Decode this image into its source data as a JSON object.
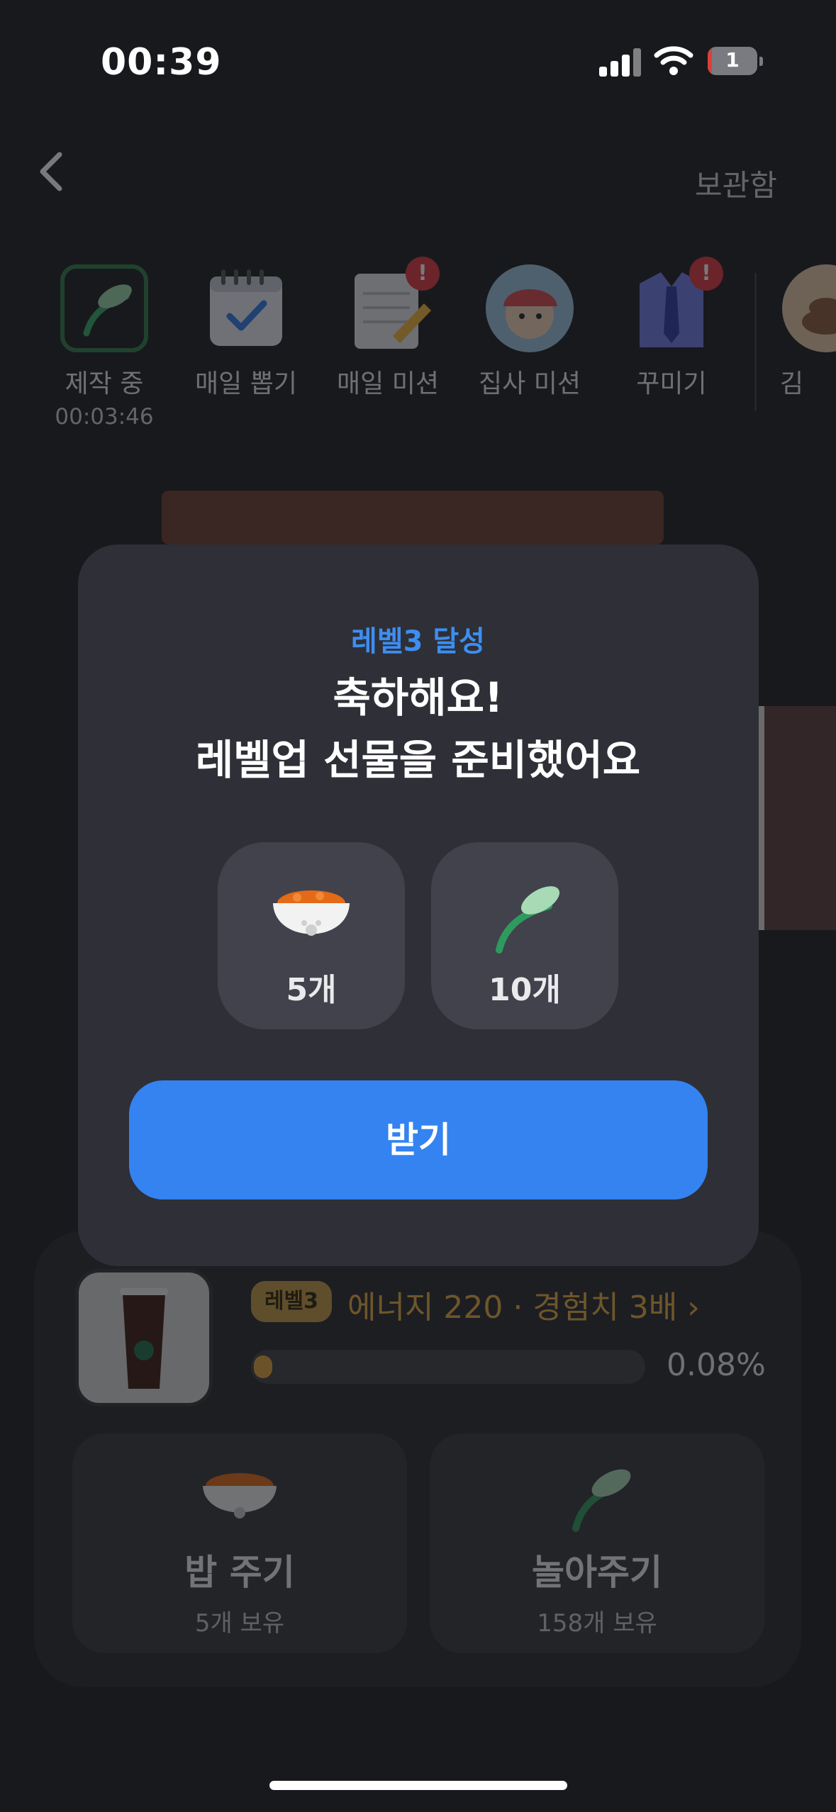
{
  "status_bar": {
    "time": "00:39",
    "battery": "1"
  },
  "header": {
    "storage_label": "보관함"
  },
  "menu": [
    {
      "label": "제작 중",
      "sub": "00:03:46",
      "icon": "leaf-icon",
      "badge": ""
    },
    {
      "label": "매일 뽑기",
      "sub": "",
      "icon": "calendar-check-icon",
      "badge": ""
    },
    {
      "label": "매일 미션",
      "sub": "",
      "icon": "notepad-pencil-icon",
      "badge": "!"
    },
    {
      "label": "집사 미션",
      "sub": "",
      "icon": "character-avatar-icon",
      "badge": ""
    },
    {
      "label": "꾸미기",
      "sub": "",
      "icon": "shirt-tie-icon",
      "badge": "!"
    },
    {
      "label": "김",
      "sub": "",
      "icon": "poop-icon",
      "badge": ""
    }
  ],
  "status_panel": {
    "level_badge": "레벨3",
    "level_info": "에너지 220 · 경험치 3배 ›",
    "progress_text": "0.08%",
    "progress_value": 0.0008
  },
  "actions": [
    {
      "label": "밥 주기",
      "sub": "5개 보유",
      "icon": "food-bowl-icon"
    },
    {
      "label": "놀아주기",
      "sub": "158개 보유",
      "icon": "leaf-icon"
    }
  ],
  "modal": {
    "level_text": "레벨3 달성",
    "title_line1": "축하해요!",
    "title_line2": "레벨업 선물을 준비했어요",
    "rewards": [
      {
        "count": "5개",
        "icon": "food-bowl-icon"
      },
      {
        "count": "10개",
        "icon": "leaf-icon"
      }
    ],
    "button_label": "받기"
  },
  "colors": {
    "accent_blue": "#3483f1",
    "level_text_blue": "#3d8ef0",
    "gold": "#e8ac3e",
    "modal_bg": "#2e2f37",
    "badge_red": "#e0363c"
  }
}
